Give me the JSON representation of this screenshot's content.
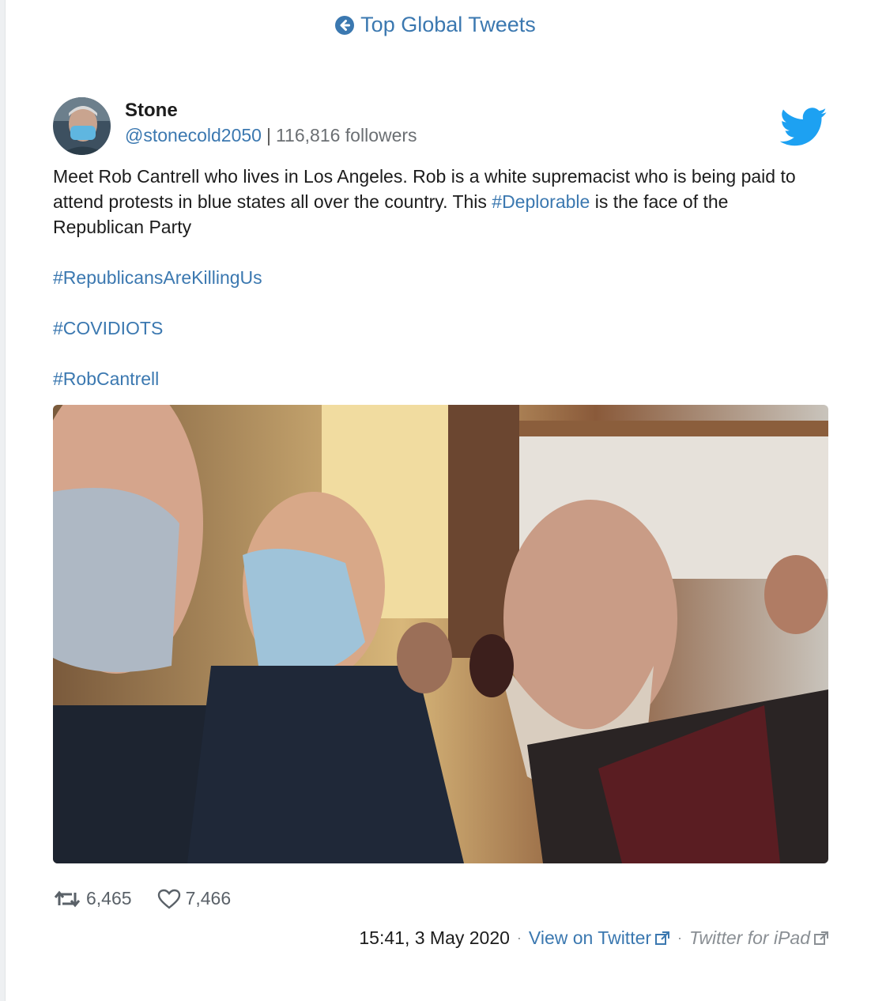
{
  "nav": {
    "back_label": "Top Global Tweets",
    "back_icon": "arrow-left-circle-icon"
  },
  "tweet": {
    "author_name": "Stone",
    "handle": "@stonecold2050",
    "separator": "|",
    "followers": "116,816 followers",
    "platform_icon": "twitter-bird-icon",
    "text_part1": "Meet Rob Cantrell who lives in Los Angeles. Rob is a white supremacist who is being paid to attend protests in blue states all over the country. This ",
    "text_hashtag_inline": "#Deplorable",
    "text_part2": " is the face of the Republican Party",
    "hashtags": [
      "#RepublicansAreKillingUs",
      "#COVIDIOTS",
      "#RobCantrell"
    ],
    "retweets": "6,465",
    "likes": "7,466",
    "timestamp": "15:41, 3 May 2020",
    "dot": "·",
    "view_link": "View on Twitter",
    "source": "Twitter for iPad"
  },
  "colors": {
    "link": "#3b78b0",
    "twitter_blue": "#1da1f2",
    "muted": "#6b6f73"
  }
}
